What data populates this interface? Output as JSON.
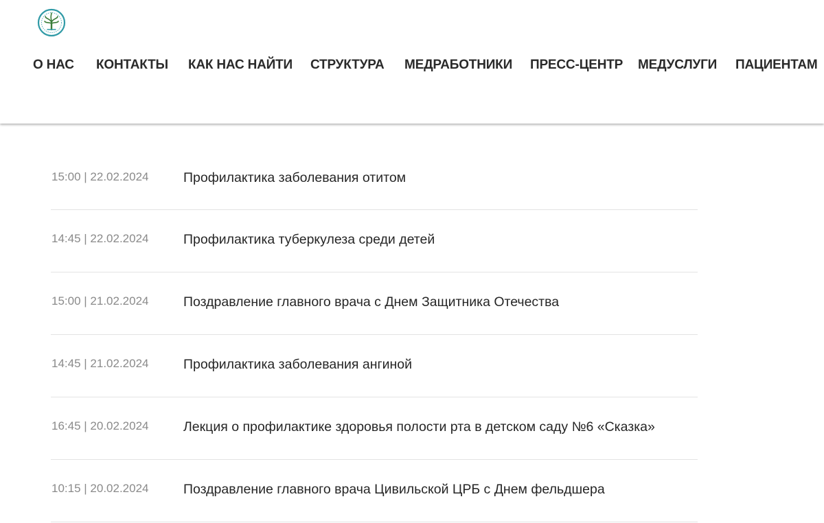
{
  "header": {
    "logo_icon": "hospital-tree-emblem-icon",
    "logo_colors": {
      "ring": "#2f9aa6",
      "tree": "#3b7d3a"
    },
    "nav": [
      {
        "label": "О НАС"
      },
      {
        "label": "КОНТАКТЫ"
      },
      {
        "label": "КАК НАС НАЙТИ"
      },
      {
        "label": "СТРУКТУРА"
      },
      {
        "label": "МЕДРАБОТНИКИ"
      },
      {
        "label": "ПРЕСС-ЦЕНТР"
      },
      {
        "label": "МЕДУСЛУГИ"
      },
      {
        "label": "ПАЦИЕНТАМ"
      }
    ]
  },
  "news": [
    {
      "time": "15:00 | 22.02.2024",
      "title": "Профилактика заболевания отитом"
    },
    {
      "time": "14:45 | 22.02.2024",
      "title": "Профилактика туберкулеза среди детей"
    },
    {
      "time": "15:00 | 21.02.2024",
      "title": "Поздравление главного врача с Днем Защитника Отечества"
    },
    {
      "time": "14:45 | 21.02.2024",
      "title": "Профилактика заболевания ангиной"
    },
    {
      "time": "16:45 | 20.02.2024",
      "title": "Лекция о профилактике здоровья полости рта в детском саду №6 «Сказка»"
    },
    {
      "time": "10:15 | 20.02.2024",
      "title": "Поздравление главного врача Цивильской ЦРБ с Днем фельдшера"
    }
  ],
  "colors": {
    "text": "#262626",
    "muted": "#8a8a8a",
    "divider": "#e3e3e3"
  }
}
